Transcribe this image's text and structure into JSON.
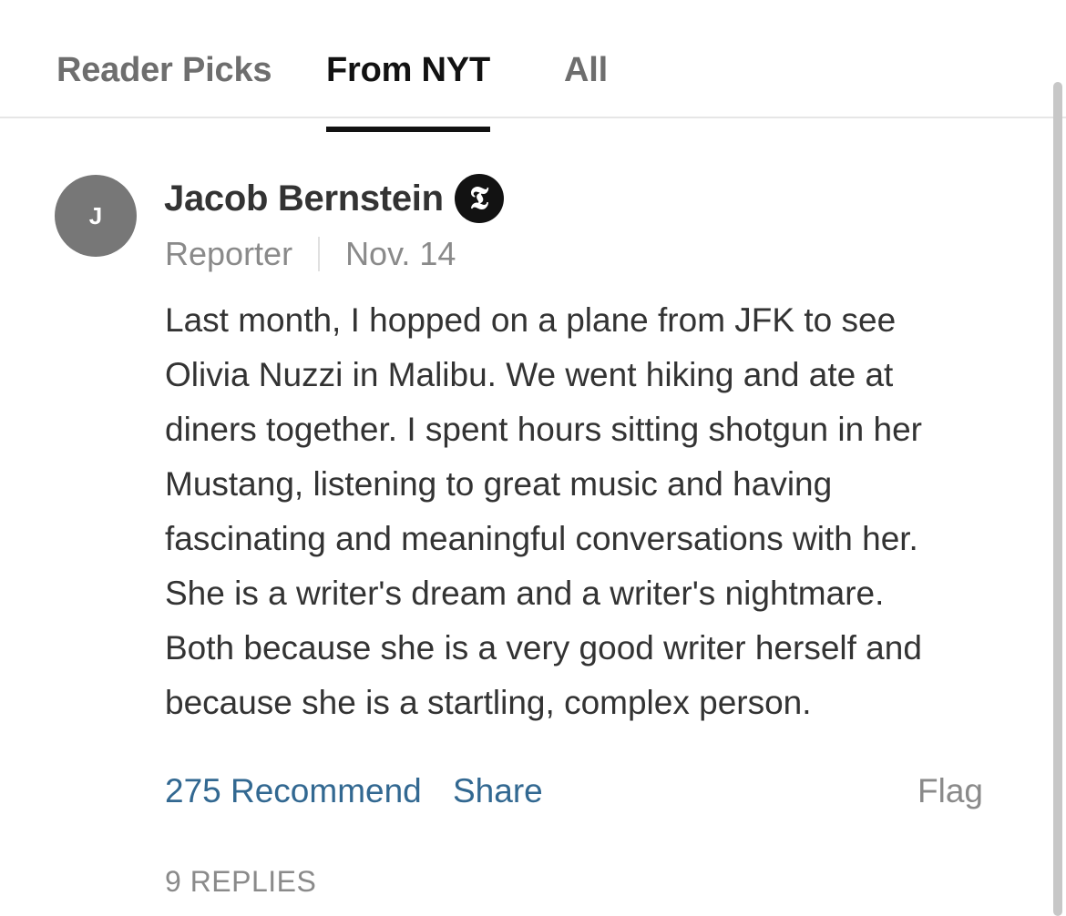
{
  "tabs": [
    {
      "label": "Reader Picks",
      "active": false
    },
    {
      "label": "From NYT",
      "active": true
    },
    {
      "label": "All",
      "active": false
    }
  ],
  "comment": {
    "avatar_initial": "J",
    "author": "Jacob Bernstein",
    "badge_glyph": "𝕿",
    "badge_icon": "nyt-logo-icon",
    "role": "Reporter",
    "date": "Nov. 14",
    "body": "Last month, I hopped on a plane from JFK to see\nOlivia Nuzzi in Malibu. We went hiking and ate at\ndiners together. I spent hours sitting shotgun in her\nMustang, listening to great music and having\nfascinating and meaningful conversations with her.\nShe is a writer's dream and a writer's nightmare.\nBoth because she is a very good writer herself and\nbecause she is a startling, complex person.",
    "recommend_label": "275 Recommend",
    "share_label": "Share",
    "flag_label": "Flag",
    "replies_label": "9 REPLIES"
  },
  "colors": {
    "link": "#326891",
    "muted": "#8a8a8a",
    "text": "#333333",
    "active_tab": "#121212"
  }
}
